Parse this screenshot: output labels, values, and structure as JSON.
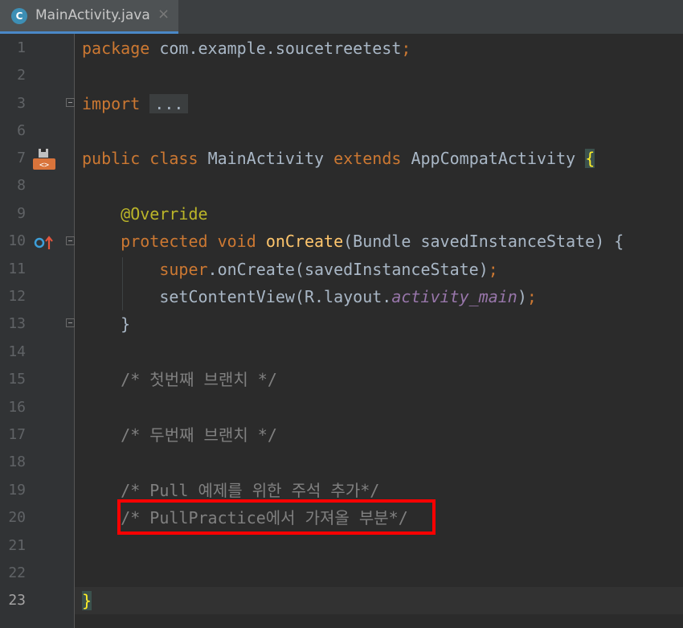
{
  "tab": {
    "label": "MainActivity.java",
    "icon": "C",
    "close": "×"
  },
  "current_line": 23,
  "lines": [
    "1",
    "2",
    "3",
    "6",
    "7",
    "8",
    "9",
    "10",
    "11",
    "12",
    "13",
    "14",
    "15",
    "16",
    "17",
    "18",
    "19",
    "20",
    "21",
    "22",
    "23"
  ],
  "code": {
    "l1": {
      "kw": "package",
      "pkg": "com.example.soucetreetest",
      "semi": ";"
    },
    "l3": {
      "kw": "import",
      "dots": "..."
    },
    "l7": {
      "kw1": "public",
      "kw2": "class",
      "name": "MainActivity",
      "kw3": "extends",
      "parent": "AppCompatActivity",
      "brace": "{"
    },
    "l9": {
      "ann": "@Override"
    },
    "l10": {
      "kw1": "protected",
      "kw2": "void",
      "fn": "onCreate",
      "args": "(Bundle savedInstanceState) {"
    },
    "l11": {
      "kw": "super",
      "rest": ".onCreate(savedInstanceState)",
      "semi": ";"
    },
    "l12": {
      "pre": "setContentView(R.layout.",
      "field": "activity_main",
      "post": ")",
      "semi": ";"
    },
    "l13": {
      "brace": "}"
    },
    "l15": {
      "comment": "/* 첫번째 브랜치 */"
    },
    "l17": {
      "comment": "/* 두번째 브랜치 */"
    },
    "l19": {
      "comment": "/* Pull 예제를 위한 주석 추가*/"
    },
    "l20": {
      "comment": "/* PullPractice에서 가져올 부분*/"
    },
    "l23": {
      "brace": "}"
    }
  },
  "colors": {
    "keyword": "#cc7832",
    "annotation": "#bbb529",
    "function": "#ffc66d",
    "static_field": "#9876aa",
    "comment": "#808080",
    "highlight_box": "#ff0000"
  },
  "icons": [
    "class-file-icon",
    "implemented-method-icon",
    "override-method-icon",
    "fold-icon"
  ]
}
